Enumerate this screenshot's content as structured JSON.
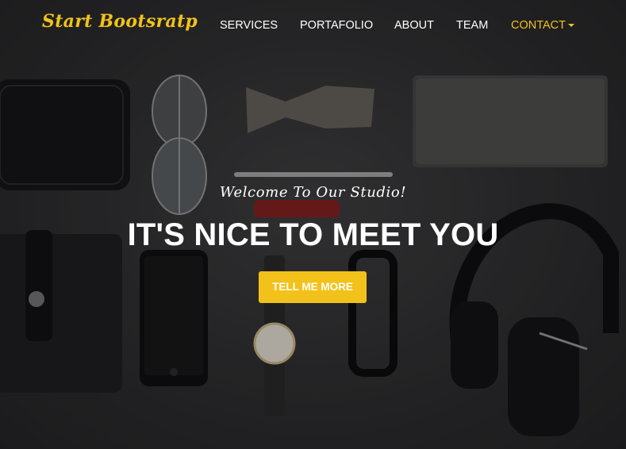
{
  "brand": {
    "name": "Start Bootsratp"
  },
  "nav": {
    "items": [
      {
        "label": "SERVICES",
        "active": false
      },
      {
        "label": "PORTAFOLIO",
        "active": false
      },
      {
        "label": "ABOUT",
        "active": false
      },
      {
        "label": "TEAM",
        "active": false
      },
      {
        "label": "CONTACT",
        "active": true,
        "dropdown": true
      }
    ]
  },
  "hero": {
    "lead": "Welcome To Our Studio!",
    "heading": "IT'S NICE TO MEET YOU",
    "cta_label": "TELL ME MORE",
    "background": "flat-lay photo of wallet, sunglasses, bow tie, notebook, pen, card holder, smartphone, watch, eyeglasses, headphones"
  },
  "colors": {
    "accent": "#f2c21a",
    "text": "#ffffff",
    "background": "#2c2c2e"
  }
}
